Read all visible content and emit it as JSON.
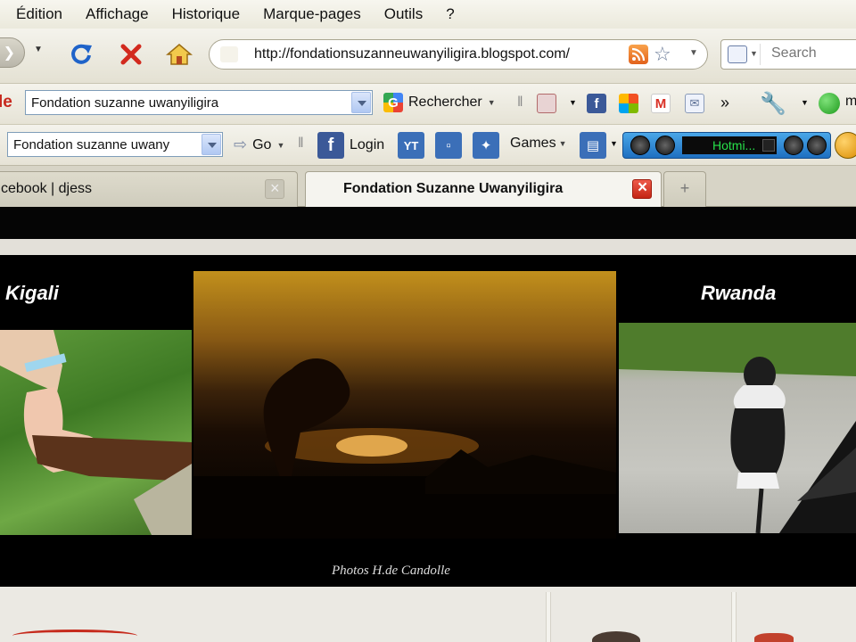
{
  "menu": {
    "items": [
      "Édition",
      "Affichage",
      "Historique",
      "Marque-pages",
      "Outils",
      "?"
    ]
  },
  "nav": {
    "url": "http://fondationsuzanneuwanyiligira.blogspot.com/",
    "search_placeholder": "Search"
  },
  "toolbar_google": {
    "logo_fragment": "le",
    "search_value": "Fondation suzanne uwanyiligira",
    "search_button_label": "Rechercher",
    "overflow_label": "»",
    "trailing_fragment": "m"
  },
  "toolbar_second": {
    "search_value": "Fondation suzanne uwany",
    "go_label": "Go",
    "login_label": "Login",
    "games_label": "Games",
    "player_screen_text": "Hotmi..."
  },
  "tabs": [
    {
      "title": "cebook | djess",
      "active": false
    },
    {
      "title": "Fondation Suzanne Uwanyiligira",
      "active": true
    }
  ],
  "page": {
    "header_left_label": "Kigali",
    "header_right_label": "Rwanda",
    "photo_credit": "Photos H.de Candolle"
  },
  "colors": {
    "menu_bg": "#ece9d8",
    "header_black": "#000000",
    "close_red": "#c42514",
    "player_blue": "#1e6fc0"
  }
}
